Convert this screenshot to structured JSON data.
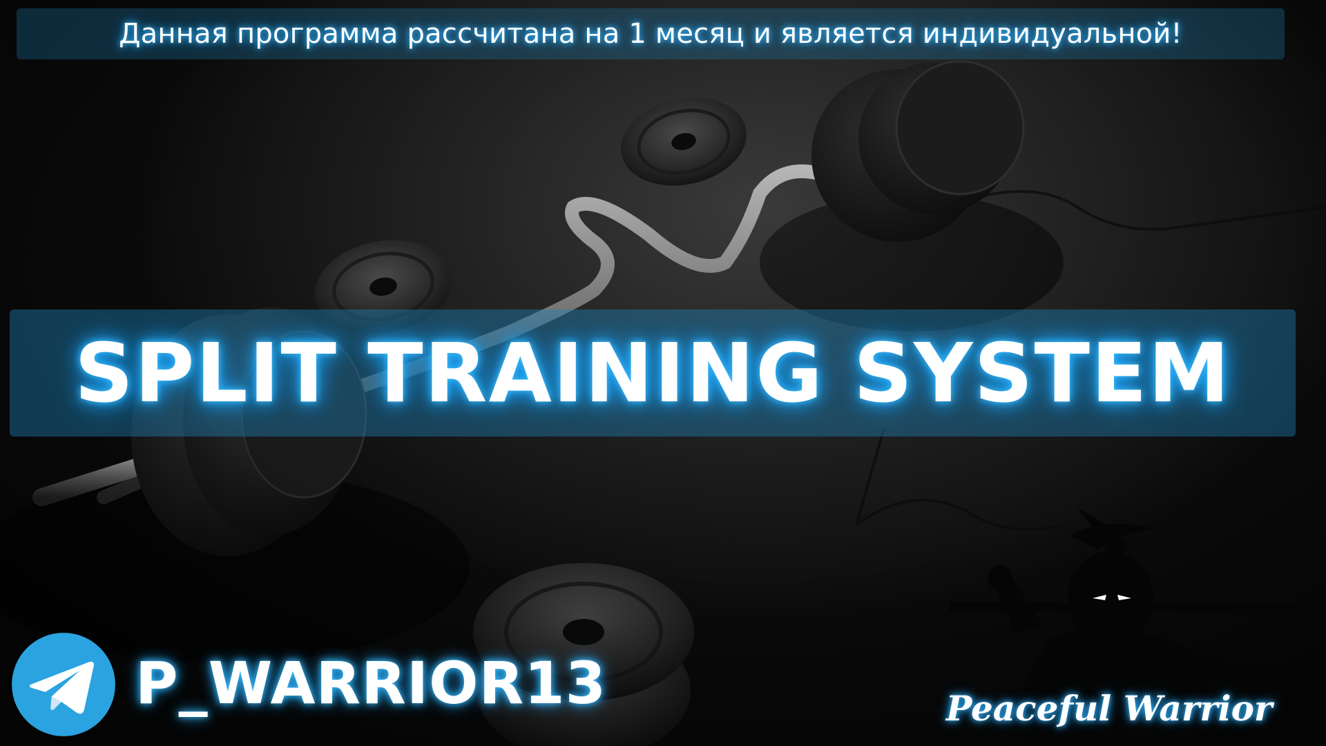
{
  "header": {
    "notice_text": "Данная программа рассчитана на 1 месяц и является индивидуальной!"
  },
  "main": {
    "title": "SPLIT TRAINING SYSTEM"
  },
  "footer": {
    "telegram_handle": "P_WARRIOR13",
    "brand_name": "Peaceful Warrior"
  },
  "icons": {
    "telegram": "telegram-icon",
    "brand_logo": "warrior-silhouette-icon"
  },
  "colors": {
    "accent_glow": "#1aa0f5",
    "banner_fill": "#1e82b9",
    "telegram_blue": "#2aa3e0",
    "text": "#ffffff"
  }
}
